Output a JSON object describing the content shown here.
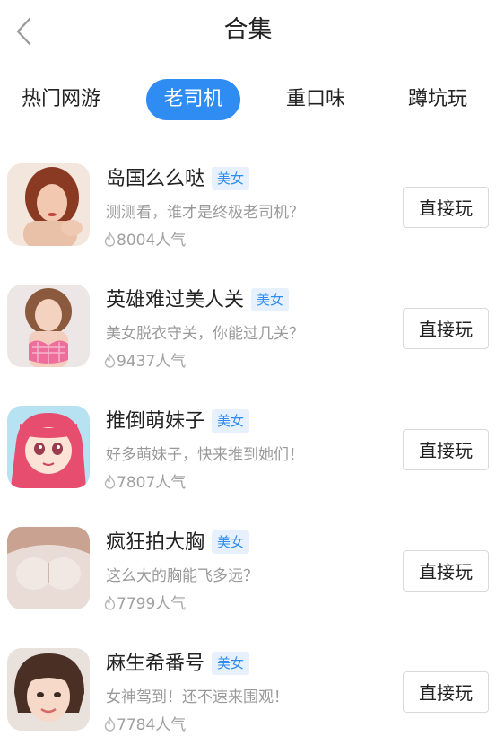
{
  "header": {
    "title": "合集",
    "back_icon": "chevron-left-icon"
  },
  "tabs": [
    {
      "label": "热门网游",
      "active": false
    },
    {
      "label": "老司机",
      "active": true
    },
    {
      "label": "重口味",
      "active": false
    },
    {
      "label": "蹲坑玩",
      "active": false
    }
  ],
  "accent_color": "#2f8cf3",
  "items": [
    {
      "name": "岛国么么哒",
      "badge": "美女",
      "desc": "测测看，谁才是终极老司机？",
      "popularity": "8004人气",
      "button": "直接玩",
      "thumb": "portrait-red-hair"
    },
    {
      "name": "英雄难过美人关",
      "badge": "美女",
      "desc": "美女脱衣守关，你能过几关？",
      "popularity": "9437人气",
      "button": "直接玩",
      "thumb": "portrait-pink-swimsuit"
    },
    {
      "name": "推倒萌妹子",
      "badge": "美女",
      "desc": "好多萌妹子，快来推到她们！",
      "popularity": "7807人气",
      "button": "直接玩",
      "thumb": "anime-pink-hair"
    },
    {
      "name": "疯狂拍大胸",
      "badge": "美女",
      "desc": "这么大的胸能飞多远？",
      "popularity": "7799人气",
      "button": "直接玩",
      "thumb": "portrait-white-top"
    },
    {
      "name": "麻生希番号",
      "badge": "美女",
      "desc": "女神驾到！还不速来围观！",
      "popularity": "7784人气",
      "button": "直接玩",
      "thumb": "portrait-short-hair"
    }
  ]
}
